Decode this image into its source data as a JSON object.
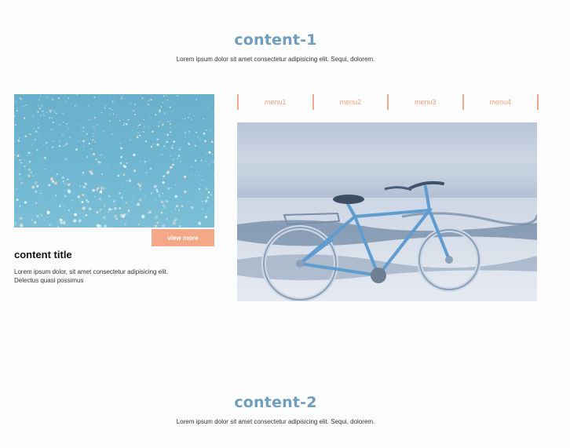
{
  "section1": {
    "title": "content-1",
    "description": "Lorem ipsum dolor sit amet consectetur adipisicing elit. Sequi, dolorem."
  },
  "card": {
    "image_icon": "glitter-photo",
    "button_label": "view more",
    "title": "content title",
    "text": "Lorem ipsum dolor, sit amet consectetur adipisicing elit. Delectus quasi possimus"
  },
  "menu": {
    "items": [
      {
        "label": "menu1"
      },
      {
        "label": "menu2"
      },
      {
        "label": "menu3"
      },
      {
        "label": "menu4"
      }
    ]
  },
  "photo": {
    "image_icon": "bicycle-beach-photo"
  },
  "section2": {
    "title": "content-2",
    "description": "Lorem ipsum dolor sit amet consectetur adipisicing elit. Sequi, dolorem."
  },
  "colors": {
    "accent": "#f4a888",
    "title": "#6f9dbf"
  }
}
